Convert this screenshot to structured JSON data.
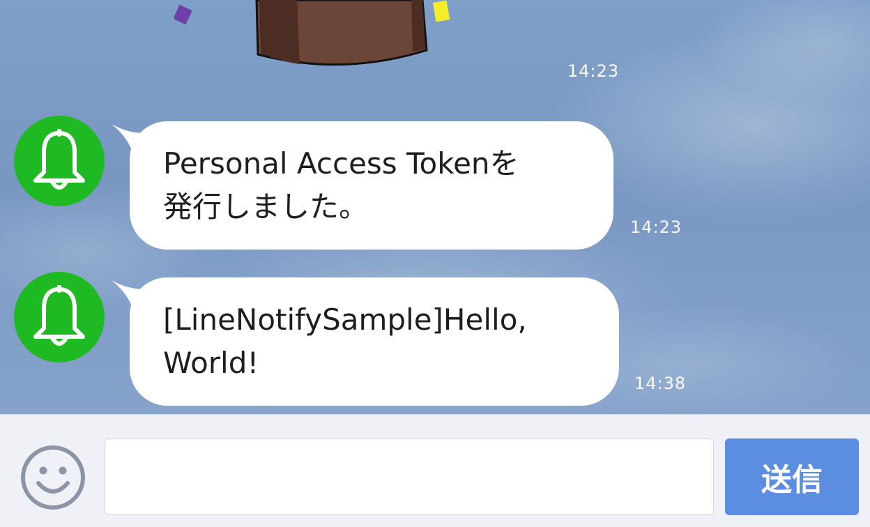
{
  "chat": {
    "sticker": {
      "icon": "sticker-image",
      "time": "14:23"
    },
    "messages": [
      {
        "sender_icon": "bell-icon",
        "avatar_color": "#1fba23",
        "text": "Personal Access Tokenを\n発行しました。",
        "time": "14:23"
      },
      {
        "sender_icon": "bell-icon",
        "avatar_color": "#1fba23",
        "text": "[LineNotifySample]Hello,\nWorld!",
        "time": "14:38"
      }
    ]
  },
  "input_bar": {
    "emoji_icon": "smiley-icon",
    "message_value": "",
    "send_label": "送信",
    "send_color": "#5b8de0"
  }
}
